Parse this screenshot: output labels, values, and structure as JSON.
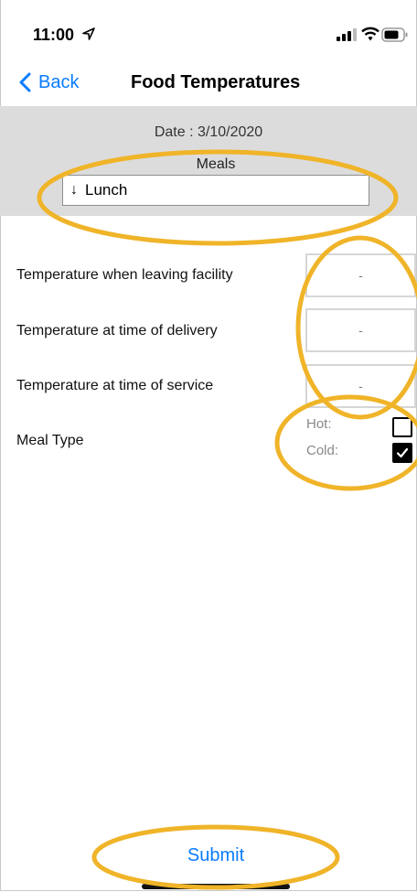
{
  "status_bar": {
    "time": "11:00"
  },
  "nav": {
    "back_label": "Back",
    "title": "Food Temperatures"
  },
  "header": {
    "date_label": "Date : 3/10/2020",
    "meals_label": "Meals",
    "meal_select": {
      "arrow": "↓",
      "value": "Lunch"
    }
  },
  "rows": [
    {
      "label": "Temperature when leaving facility",
      "value": "-"
    },
    {
      "label": "Temperature at time of delivery",
      "value": "-"
    },
    {
      "label": "Temperature at time of service",
      "value": "-"
    }
  ],
  "meal_type": {
    "label": "Meal Type",
    "hot_label": "Hot:",
    "cold_label": "Cold:",
    "hot_checked": false,
    "cold_checked": true
  },
  "submit_label": "Submit",
  "colors": {
    "accent": "#0a7cff",
    "header_bg": "#dcdcdc",
    "annotation": "#f0b429"
  }
}
